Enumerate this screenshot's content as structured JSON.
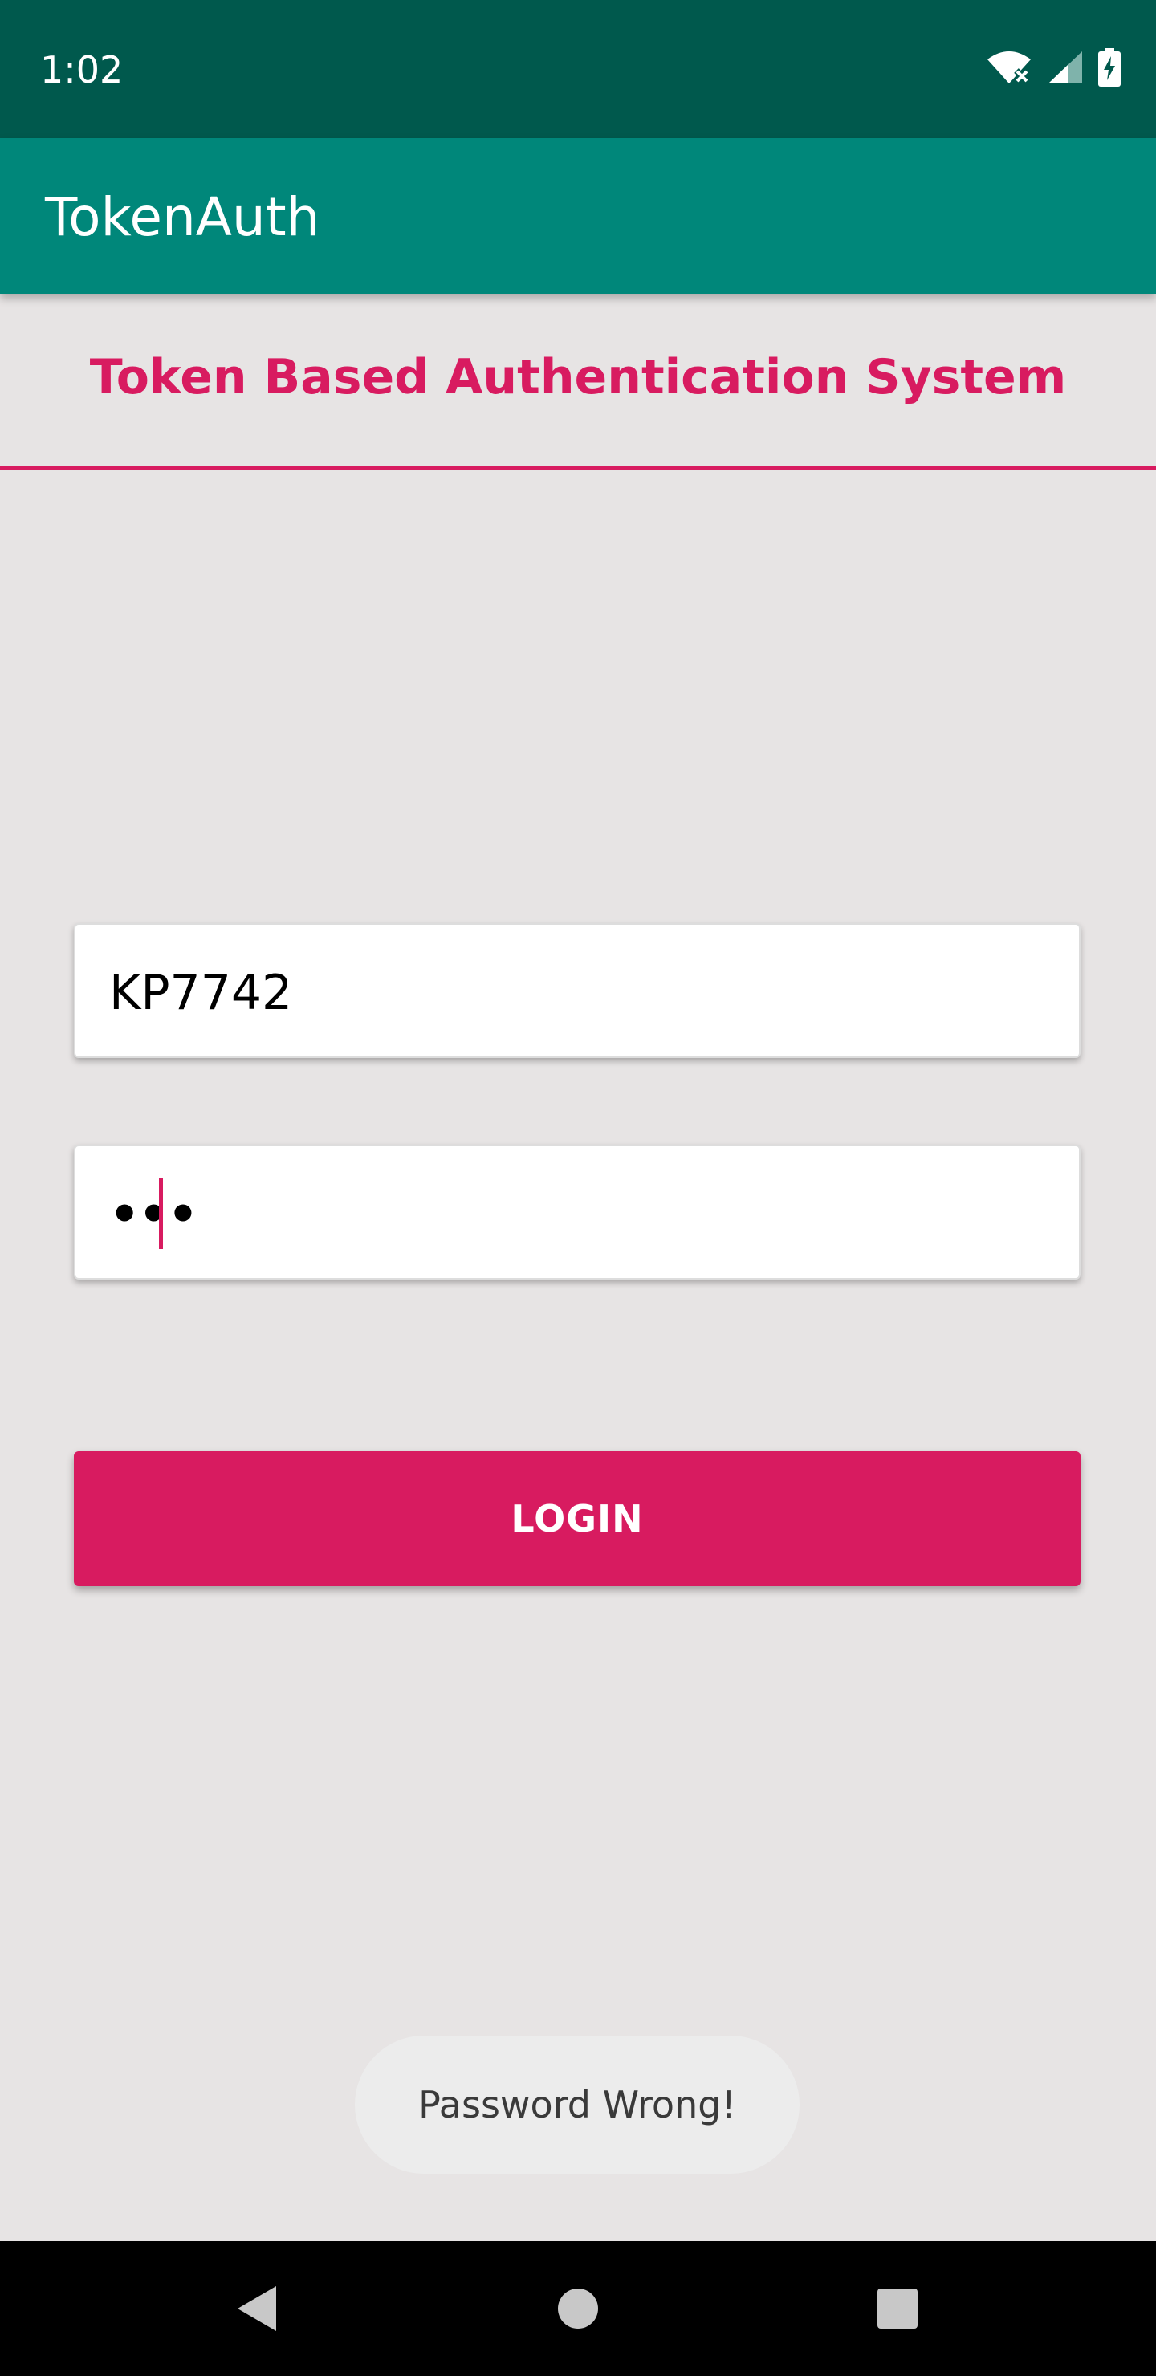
{
  "status_bar": {
    "time": "1:02",
    "icons": [
      "wifi-off-icon",
      "cell-signal-icon",
      "battery-charging-icon"
    ]
  },
  "app_bar": {
    "title": "TokenAuth"
  },
  "heading": {
    "text": "Token Based Authentication System"
  },
  "form": {
    "username_value": "KP7742",
    "password_value": "•••"
  },
  "login_button": {
    "label": "LOGIN"
  },
  "toast": {
    "message": "Password Wrong!"
  },
  "colors": {
    "status_bar": "#00594d",
    "app_bar": "#00877a",
    "accent": "#d81b60",
    "background": "#e7e4e4"
  },
  "nav_bar": {
    "icons": [
      "back-icon",
      "home-icon",
      "recents-icon"
    ]
  }
}
